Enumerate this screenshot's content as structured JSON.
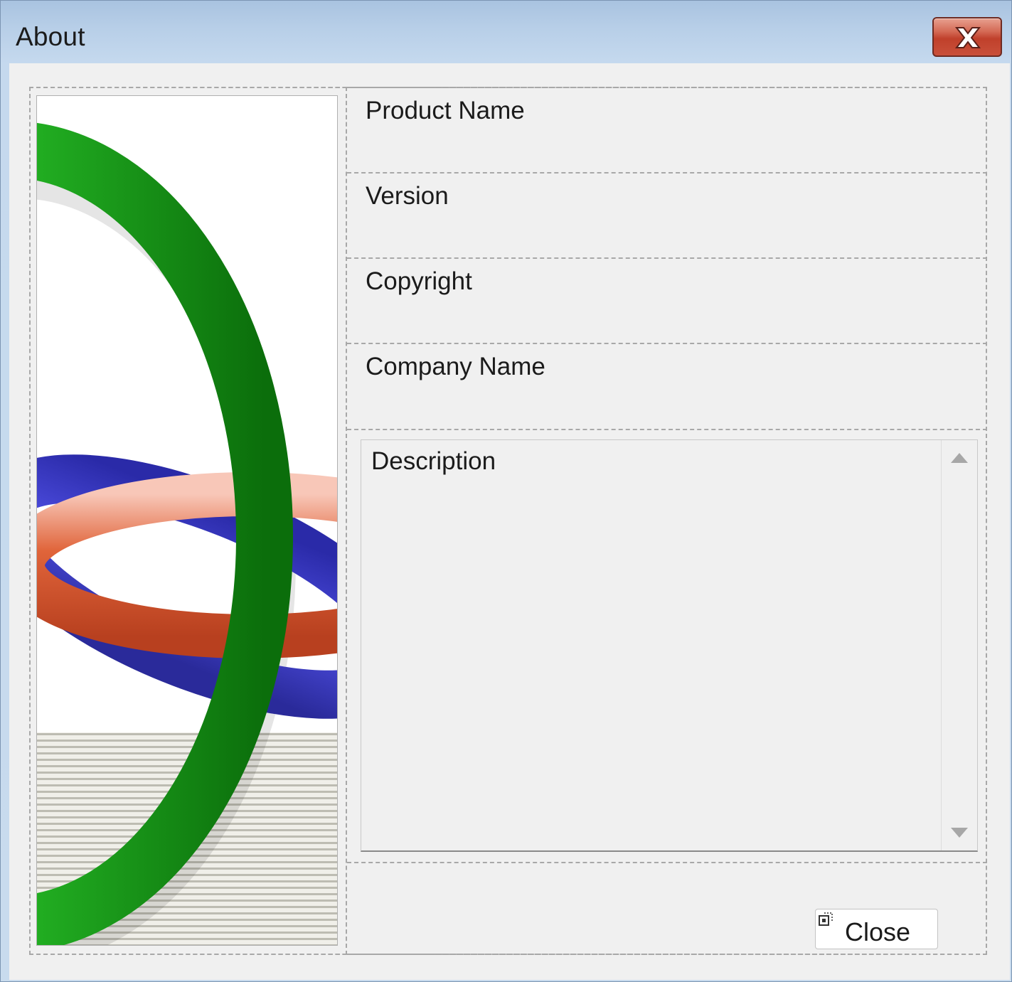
{
  "window": {
    "title": "About"
  },
  "titlebar": {
    "close_icon": "close-x-icon"
  },
  "fields": {
    "product_name": "Product Name",
    "version": "Version",
    "copyright": "Copyright",
    "company_name": "Company Name"
  },
  "description": {
    "text": "Description"
  },
  "buttons": {
    "close_label": "Close"
  },
  "colors": {
    "ring_green": "#1a9e1a",
    "ring_orange": "#d9582e",
    "ring_blue": "#3b3bc8",
    "dialog_bg": "#f0f0f0",
    "titlebar_close": "#c7432e"
  }
}
